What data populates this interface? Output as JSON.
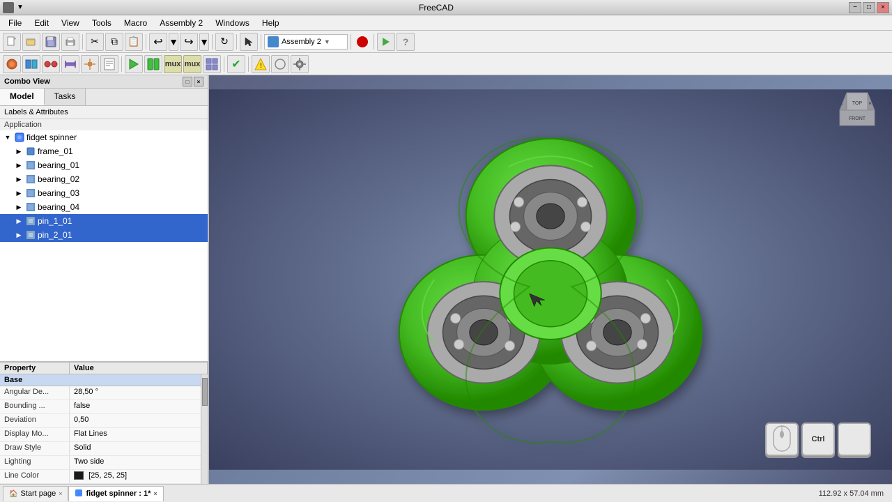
{
  "app": {
    "title": "FreeCAD",
    "icon": "freecad-icon"
  },
  "title_bar": {
    "title": "FreeCAD",
    "min_btn": "−",
    "max_btn": "□",
    "close_btn": "×",
    "menu_icon": "▼"
  },
  "menu": {
    "items": [
      "File",
      "Edit",
      "View",
      "Tools",
      "Macro",
      "Assembly 2",
      "Windows",
      "Help"
    ]
  },
  "toolbar1": {
    "dropdown_label": "Assembly 2",
    "record_tooltip": "record macro"
  },
  "left_panel": {
    "title": "Combo View",
    "tabs": [
      "Model",
      "Tasks"
    ],
    "active_tab": "Model",
    "labels_section": "Labels & Attributes",
    "application_label": "Application",
    "tree": {
      "root": {
        "label": "fidget spinner",
        "expanded": true,
        "children": [
          {
            "label": "frame_01",
            "icon": "part-icon",
            "expanded": false
          },
          {
            "label": "bearing_01",
            "icon": "cube-icon",
            "expanded": false
          },
          {
            "label": "bearing_02",
            "icon": "cube-icon",
            "expanded": false
          },
          {
            "label": "bearing_03",
            "icon": "cube-icon",
            "expanded": false
          },
          {
            "label": "bearing_04",
            "icon": "cube-icon",
            "expanded": false
          },
          {
            "label": "pin_1_01",
            "icon": "pin-icon",
            "expanded": false,
            "selected": true
          },
          {
            "label": "pin_2_01",
            "icon": "pin-icon",
            "expanded": false,
            "selected": true
          }
        ]
      }
    }
  },
  "property_panel": {
    "col_property": "Property",
    "col_value": "Value",
    "section": "Base",
    "rows": [
      {
        "name": "Angular De...",
        "value": "28,50 °"
      },
      {
        "name": "Bounding ...",
        "value": "false"
      },
      {
        "name": "Deviation",
        "value": "0,50"
      },
      {
        "name": "Display Mo...",
        "value": "Flat Lines"
      },
      {
        "name": "Draw Style",
        "value": "Solid"
      },
      {
        "name": "Lighting",
        "value": "Two side"
      },
      {
        "name": "Line Color",
        "value": "[25, 25, 25]",
        "has_swatch": true
      }
    ]
  },
  "bottom_tabs": [
    {
      "label": "Start page",
      "closeable": true
    },
    {
      "label": "fidget spinner : 1*",
      "closeable": true,
      "active": true,
      "icon": "model-icon"
    }
  ],
  "status_bar": {
    "dimensions": "112.92 x 57.04 mm"
  },
  "keyboard_hint": {
    "keys": [
      "Ctrl",
      ""
    ]
  },
  "viewport": {
    "spinner_color": "#44bb22",
    "bearing_color": "#aaaaaa",
    "bg_color1": "#5a6080",
    "bg_color2": "#7080a0"
  }
}
